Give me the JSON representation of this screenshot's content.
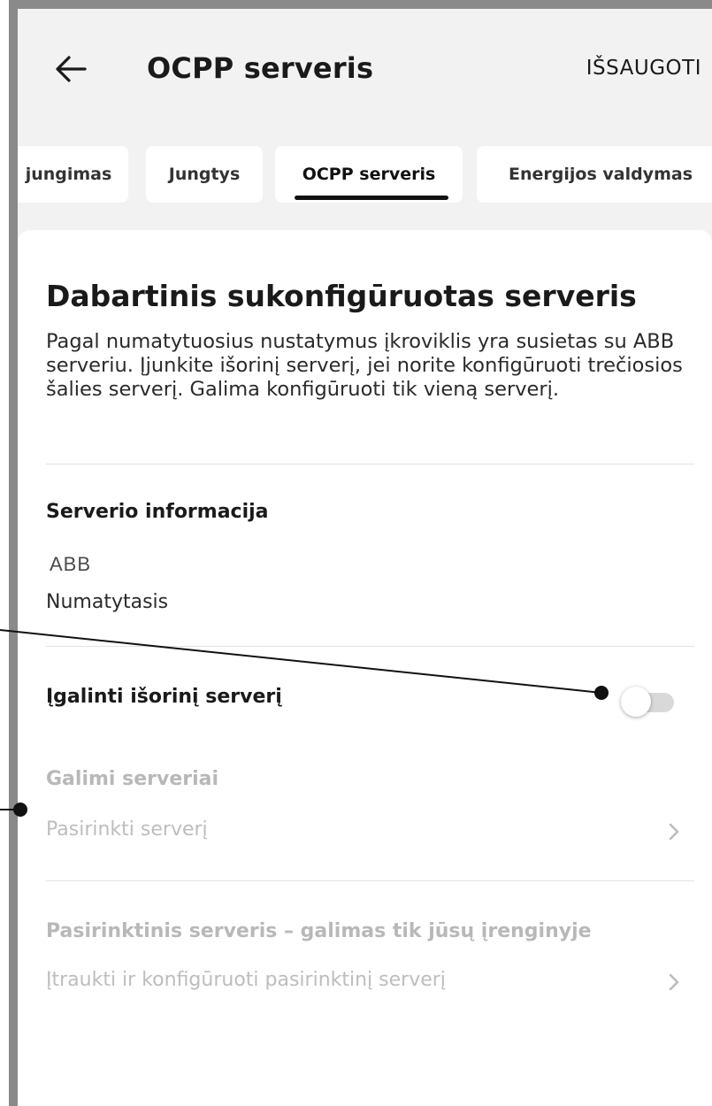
{
  "header": {
    "title": "OCPP serveris",
    "save_label": "IŠSAUGOTI"
  },
  "tabs": [
    {
      "label": "jungimas"
    },
    {
      "label": "Jungtys"
    },
    {
      "label": "OCPP serveris",
      "active": true
    },
    {
      "label": "Energijos valdymas"
    }
  ],
  "section": {
    "title": "Dabartinis sukonfigūruotas serveris",
    "description": "Pagal numatytuosius nustatymus įkroviklis yra susietas su ABB serveriu. Įjunkite išorinį serverį, jei norite konfigūruoti trečiosios šalies serverį. Galima konfigūruoti tik vieną serverį."
  },
  "server_info": {
    "label": "Serverio informacija",
    "logo_text": "ABB",
    "value": "Numatytasis"
  },
  "external_server": {
    "label": "Įgalinti išorinį serverį",
    "enabled": false
  },
  "available_servers": {
    "label": "Galimi serveriai",
    "placeholder": "Pasirinkti serverį"
  },
  "custom_server": {
    "label": "Pasirinktinis serveris – galimas tik jūsų įrenginyje",
    "action": "Įtraukti ir konfigūruoti pasirinktinį serverį"
  },
  "colors": {
    "background": "#f2f2f2",
    "card": "#ffffff",
    "text": "#1a1a1a",
    "muted": "#b8b8b8",
    "toggle_track": "#d9d9d9",
    "frame": "#8a8a8a"
  },
  "icons": {
    "back": "arrow-left-icon",
    "chevron": "chevron-right-icon"
  }
}
